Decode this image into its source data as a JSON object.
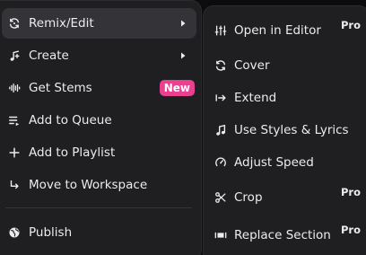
{
  "main_menu": {
    "items": [
      {
        "label": "Remix/Edit",
        "icon": "remix-icon",
        "has_submenu": true
      },
      {
        "label": "Create",
        "icon": "music-note-plus-icon",
        "has_submenu": true
      },
      {
        "label": "Get Stems",
        "icon": "waveform-icon",
        "badge": "New"
      },
      {
        "label": "Add to Queue",
        "icon": "queue-icon"
      },
      {
        "label": "Add to Playlist",
        "icon": "plus-icon"
      },
      {
        "label": "Move to Workspace",
        "icon": "move-arrow-icon"
      },
      {
        "label": "Publish",
        "icon": "globe-icon"
      }
    ]
  },
  "submenu": {
    "items": [
      {
        "label": "Open in Editor",
        "icon": "sliders-icon",
        "pro": "Pro"
      },
      {
        "label": "Cover",
        "icon": "cover-icon"
      },
      {
        "label": "Extend",
        "icon": "extend-icon"
      },
      {
        "label": "Use Styles & Lyrics",
        "icon": "music-note-icon"
      },
      {
        "label": "Adjust Speed",
        "icon": "speed-icon"
      },
      {
        "label": "Crop",
        "icon": "scissors-icon",
        "pro": "Pro"
      },
      {
        "label": "Replace Section",
        "icon": "replace-section-icon",
        "pro": "Pro"
      }
    ]
  },
  "colors": {
    "background": "#0c0c0d",
    "menu_bg": "#1f1f22",
    "hover_bg": "#333338",
    "text": "#ececee",
    "badge_new": "#e8418f"
  }
}
